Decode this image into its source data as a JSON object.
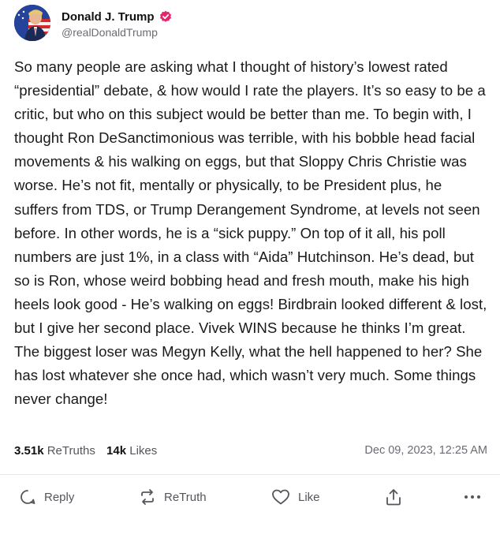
{
  "author": {
    "name": "Donald J. Trump",
    "handle": "@realDonaldTrump",
    "verified_color": "#e5246b"
  },
  "post": {
    "text": "So many people are asking what I thought of history’s lowest rated “presidential” debate, & how would I rate the players. It’s so easy to be a critic, but who on this subject would be better than me. To begin with, I thought Ron DeSanctimonious was terrible, with his bobble head facial movements & his walking on eggs, but that Sloppy Chris Christie was worse. He’s not fit, mentally or physically, to be President plus, he suffers from TDS, or Trump Derangement Syndrome, at levels not seen before. In other words, he is a “sick puppy.” On top of it all, his poll numbers are just 1%, in a class with “Aida” Hutchinson. He’s dead, but so is Ron, whose weird bobbing head and fresh mouth, make his high heels look good - He’s walking on eggs! Birdbrain looked different & lost, but I give her second place. Vivek WINS because he thinks I’m great. The biggest loser was Megyn Kelly, what the hell happened to her? She has lost whatever she once had, which wasn’t very much. Some things never change!"
  },
  "stats": {
    "retruths_count": "3.51k",
    "retruths_label": "ReTruths",
    "likes_count": "14k",
    "likes_label": "Likes",
    "date": "Dec 09, 2023, 12:25 AM"
  },
  "actions": {
    "reply": "Reply",
    "retruth": "ReTruth",
    "like": "Like"
  },
  "icons": [
    "verified-badge-icon",
    "reply-icon",
    "retruth-icon",
    "heart-icon",
    "share-icon",
    "more-icon"
  ]
}
